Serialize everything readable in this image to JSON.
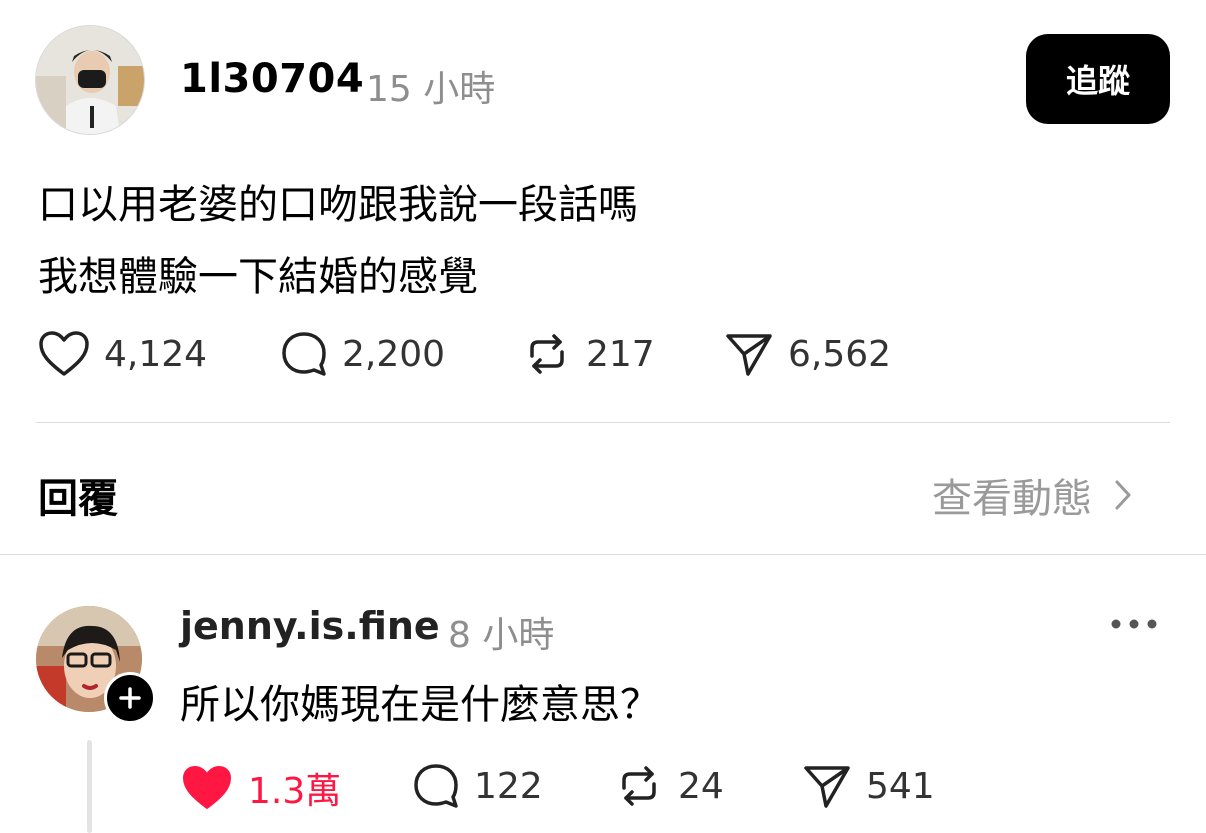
{
  "post": {
    "username": "1l30704",
    "time": "15 小時",
    "follow_label": "追蹤",
    "text_lines": [
      "口以用老婆的口吻跟我說一段話嗎",
      "我想體驗一下結婚的感覺"
    ],
    "stats": {
      "likes": "4,124",
      "comments": "2,200",
      "reposts": "217",
      "shares": "6,562"
    }
  },
  "replies_section": {
    "title": "回覆",
    "view_activity_label": "查看動態"
  },
  "reply": {
    "username": "jenny.is.fine",
    "time": "8 小時",
    "text": "所以你媽現在是什麼意思？",
    "stats": {
      "likes": "1.3萬",
      "comments": "122",
      "reposts": "24",
      "shares": "541"
    },
    "liked": true
  },
  "colors": {
    "like_active": "#ff1744",
    "muted": "#8e8e8e",
    "follow_bg": "#000000"
  },
  "icons": [
    "heart-icon",
    "comment-icon",
    "repost-icon",
    "share-icon",
    "chevron-right-icon",
    "more-icon",
    "plus-icon"
  ]
}
